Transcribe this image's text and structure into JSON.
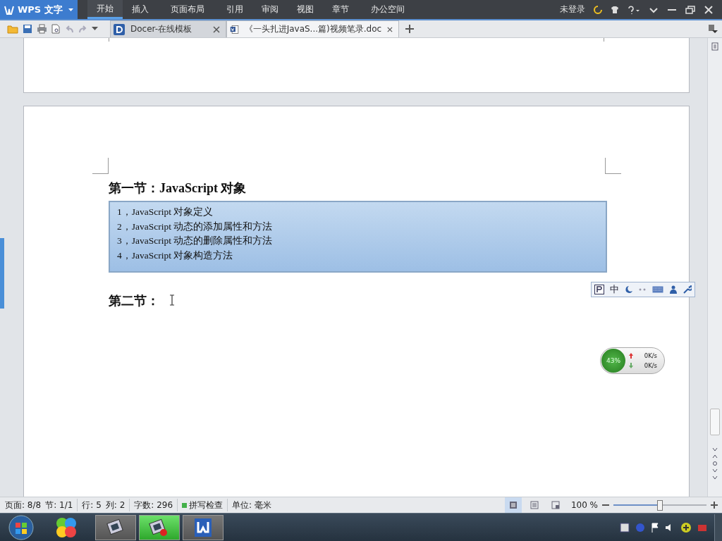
{
  "app_button": {
    "label": "WPS 文字"
  },
  "ribbon_tabs": [
    {
      "label": "开始",
      "selected": true
    },
    {
      "label": "插入",
      "selected": false
    },
    {
      "label": "页面布局",
      "selected": false
    },
    {
      "label": "引用",
      "selected": false
    },
    {
      "label": "审阅",
      "selected": false
    },
    {
      "label": "视图",
      "selected": false
    },
    {
      "label": "章节",
      "selected": false
    },
    {
      "label": "办公空间",
      "selected": false
    }
  ],
  "account": {
    "login": "未登录"
  },
  "doc_tabs": [
    {
      "title": "Docer-在线模板",
      "kind": "docer",
      "selected": false
    },
    {
      "title": "《一头扎进JavaS...篇)视频笔录.doc",
      "kind": "doc",
      "selected": true
    }
  ],
  "document": {
    "heading_1": "第一节：JavaScript 对象",
    "outline_items": [
      "1，JavaScript 对象定义",
      "2，JavaScript 动态的添加属性和方法",
      "3，JavaScript 动态的删除属性和方法",
      "4，JavaScript 对象构造方法"
    ],
    "heading_2": "第二节："
  },
  "ime_toolbar": {
    "mode": "中"
  },
  "network_widget": {
    "percent": "43%",
    "upload": "0K/s",
    "download": "0K/s"
  },
  "status_bar": {
    "items": [
      "页面: 8/8",
      "节: 1/1",
      "行: 5",
      "列: 2",
      "字数: 296",
      "拼写检查",
      "单位: 毫米"
    ],
    "view_buttons": [
      {
        "selected": true
      },
      {
        "selected": false
      },
      {
        "selected": false
      }
    ],
    "zoom": {
      "reading": "100 %",
      "level": 0.5
    }
  },
  "taskbar": {
    "apps": [
      {
        "selected": false
      },
      {
        "selected": true
      },
      {
        "selected": false
      }
    ]
  }
}
